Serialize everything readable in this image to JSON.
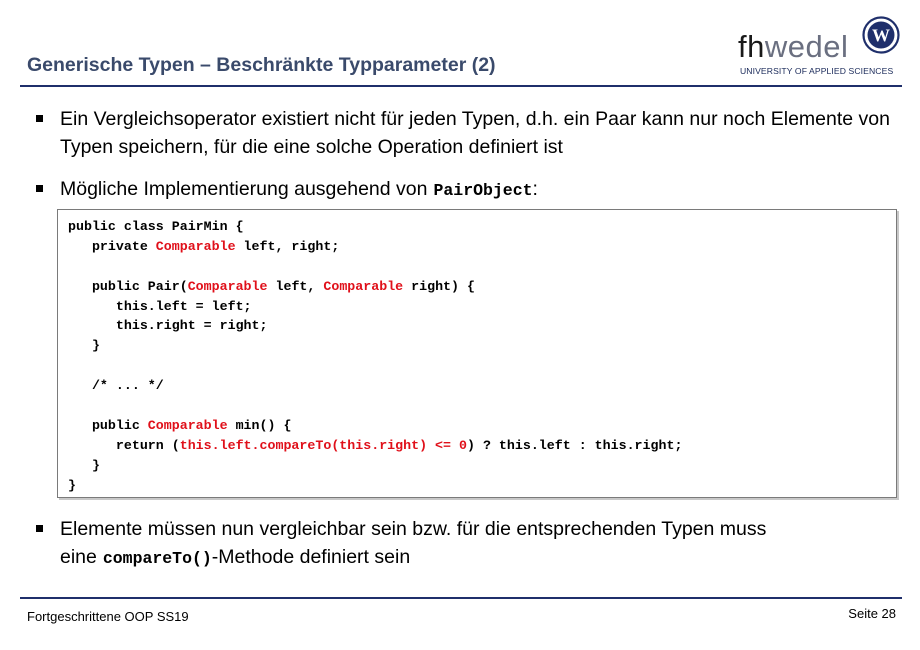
{
  "header": {
    "title": "Generische Typen – Beschränkte Typparameter (2)",
    "logo": {
      "fh": "fh",
      "wedel": "wedel",
      "subtitle": "UNIVERSITY OF APPLIED SCIENCES",
      "emblem_letter": "W",
      "emblem_icon": "fh-wedel-emblem-icon"
    },
    "rule_color": "#1f2f6b",
    "title_color": "#3a4a6b"
  },
  "bullets": [
    {
      "text": "Ein Vergleichsoperator existiert nicht für jeden Typen, d.h. ein Paar kann nur noch Elemente von Typen speichern, für die eine solche Operation definiert ist"
    },
    {
      "text": "Mögliche Implementierung ausgehend von",
      "code": "PairObject",
      "suffix": ":"
    },
    {
      "text_before": "Elemente müssen nun vergleichbar sein bzw. für die entsprechenden Typen muss eine",
      "code": "compareTo()",
      "text_after": "-Methode definiert sein"
    }
  ],
  "code_block": {
    "highlight_color": "#e0101a",
    "lines": [
      [
        {
          "t": "public class PairMin {"
        }
      ],
      [
        {
          "t": "   private "
        },
        {
          "t": "Comparable",
          "hl": true
        },
        {
          "t": " left, right;"
        }
      ],
      [
        {
          "t": ""
        }
      ],
      [
        {
          "t": "   public Pair("
        },
        {
          "t": "Comparable",
          "hl": true
        },
        {
          "t": " left, "
        },
        {
          "t": "Comparable",
          "hl": true
        },
        {
          "t": " right) {"
        }
      ],
      [
        {
          "t": "      this.left = left;"
        }
      ],
      [
        {
          "t": "      this.right = right;"
        }
      ],
      [
        {
          "t": "   }"
        }
      ],
      [
        {
          "t": ""
        }
      ],
      [
        {
          "t": "   /* ... */"
        }
      ],
      [
        {
          "t": ""
        }
      ],
      [
        {
          "t": "   public "
        },
        {
          "t": "Comparable",
          "hl": true
        },
        {
          "t": " min() {"
        }
      ],
      [
        {
          "t": "      return ("
        },
        {
          "t": "this.left.compareTo(this.right) <= 0",
          "hl": true
        },
        {
          "t": ") ? this.left : this.right;"
        }
      ],
      [
        {
          "t": "   }"
        }
      ],
      [
        {
          "t": "}"
        }
      ]
    ]
  },
  "footer": {
    "course": "Fortgeschrittene OOP SS19",
    "page": "Seite 28"
  }
}
